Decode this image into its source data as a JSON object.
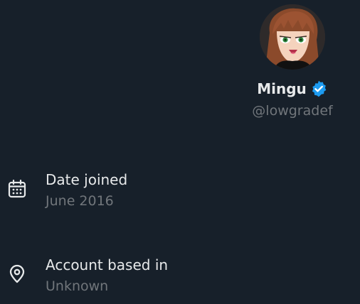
{
  "profile": {
    "display_name": "Mingu",
    "handle": "@lowgradef",
    "verified": true,
    "verified_color": "#1d9bf0",
    "avatar_icon": "anime-girl-avatar"
  },
  "about": [
    {
      "icon": "calendar-icon",
      "label": "Date joined",
      "value": "June 2016"
    },
    {
      "icon": "location-pin-icon",
      "label": "Account based in",
      "value": "Unknown"
    }
  ],
  "colors": {
    "background": "#17202a",
    "primary_text": "#e7e9ea",
    "secondary_text": "#71767b"
  }
}
